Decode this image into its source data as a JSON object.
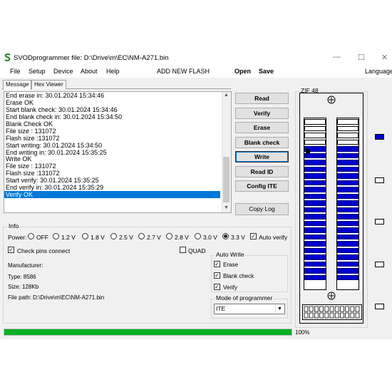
{
  "title_bar": {
    "title": "SVODprogrammer file: D:\\Drive\\m\\EC\\NM-A271.bin",
    "minimize_glyph": "—",
    "maximize_glyph": "☐",
    "close_glyph": "✕",
    "app_icon": "svod-logo-icon"
  },
  "menu": {
    "items": [
      "File",
      "Setup",
      "Device",
      "About",
      "Help"
    ],
    "add_new_flash": "ADD NEW FLASH",
    "open": "Open",
    "save": "Save",
    "language": "Language"
  },
  "tabs": [
    {
      "label": "Message",
      "active": true
    },
    {
      "label": "Hex Viewer",
      "active": false
    }
  ],
  "log": {
    "lines": [
      "End erase in: 30.01.2024 15:34:46",
      "Erase OK",
      "Start blank check: 30.01.2024 15:34:46",
      "End blank check in: 30.01.2024 15:34:50",
      "Blank Check OK",
      "File size : 131072",
      "Flash size :131072",
      "Start writing: 30.01.2024 15:34:50",
      "End writing in: 30.01.2024 15:35:25",
      "Write OK",
      "File size : 131072",
      "Flash size :131072",
      "Start verify: 30.01.2024 15:35:25",
      "End verify in: 30.01.2024 15:35:29",
      "Verify OK"
    ],
    "selected_index": 14
  },
  "buttons": {
    "read": "Read",
    "verify": "Verify",
    "erase": "Erase",
    "blank_check": "Blank check",
    "write": "Write",
    "read_id": "Read ID",
    "config_ite": "Config ITE",
    "copy_log": "Copy Log"
  },
  "info": {
    "group_label": "Info",
    "power_label": "Power:",
    "power_options": [
      "OFF",
      "1.2 V",
      "1.8 V",
      "2.5 V",
      "2.7 V",
      "2.8 V",
      "3.0 V",
      "3.3 V"
    ],
    "power_selected": "3.3 V",
    "auto_verify": {
      "label": "Auto verify",
      "checked": true
    },
    "check_pins": {
      "label": "Check pins connect",
      "checked": true
    },
    "quad": {
      "label": "QUAD",
      "checked": false
    },
    "manufacturer": "Manufacturer:",
    "type": "Type: 8586",
    "size": "Size: 128Kb",
    "file_path": "File path: D:\\Drive\\m\\EC\\NM-A271.bin"
  },
  "auto_write": {
    "group_label": "Auto Write",
    "erase": {
      "label": "Erase",
      "checked": true
    },
    "blank_check": {
      "label": "Blank check",
      "checked": true
    },
    "verify": {
      "label": "Verify",
      "checked": true
    }
  },
  "mode": {
    "group_label": "Mode of programmer",
    "value": "ITE"
  },
  "zif": {
    "group_label": "ZIF 48",
    "rows_per_column": 24,
    "empty_rows": 4,
    "chip_start_row": 4,
    "pin1_marker_row": 4
  },
  "side_pins": [
    true,
    false,
    false,
    false,
    false
  ],
  "progress": {
    "value": 1.0,
    "text": "100%",
    "color": "#06b025"
  },
  "colors": {
    "selection": "#0078d7",
    "pin_blue": "#0000cc",
    "progress": "#06b025"
  }
}
